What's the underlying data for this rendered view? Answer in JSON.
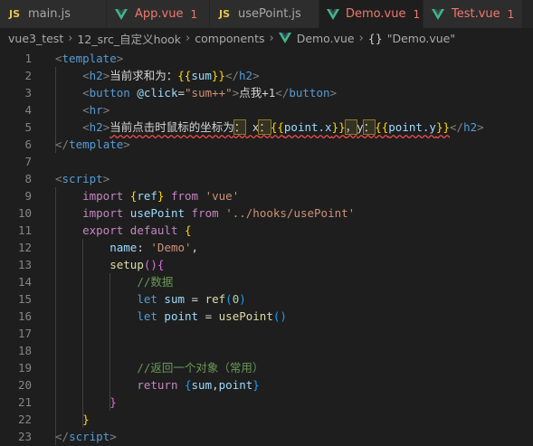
{
  "tabs": [
    {
      "icon": "js-file-icon",
      "icon_text": "JS",
      "label": "main.js",
      "badge": "",
      "active": false,
      "error": false,
      "close": ""
    },
    {
      "icon": "vue-file-icon",
      "icon_text": "",
      "label": "App.vue",
      "badge": "1",
      "active": false,
      "error": true,
      "close": ""
    },
    {
      "icon": "js-file-icon",
      "icon_text": "JS",
      "label": "usePoint.js",
      "badge": "",
      "active": false,
      "error": false,
      "close": ""
    },
    {
      "icon": "vue-file-icon",
      "icon_text": "",
      "label": "Demo.vue",
      "badge": "1",
      "active": true,
      "error": true,
      "close": "×"
    },
    {
      "icon": "vue-file-icon",
      "icon_text": "",
      "label": "Test.vue",
      "badge": "1",
      "active": false,
      "error": true,
      "close": ""
    }
  ],
  "breadcrumb": {
    "items": [
      "vue3_test",
      "12_src_自定义hook",
      "components",
      "Demo.vue"
    ],
    "symbol_icon": "{}",
    "symbol_label": "\"Demo.vue\""
  },
  "colors": {
    "background": "#1e1e1e",
    "tab_bar": "#252526",
    "error_text": "#f0786e",
    "vue_green": "#41b883",
    "js_yellow": "#e6c84f"
  },
  "code_lines": [
    {
      "n": "1"
    },
    {
      "n": "2"
    },
    {
      "n": "3"
    },
    {
      "n": "4"
    },
    {
      "n": "5"
    },
    {
      "n": "6"
    },
    {
      "n": "7"
    },
    {
      "n": "8"
    },
    {
      "n": "9"
    },
    {
      "n": "10"
    },
    {
      "n": "11"
    },
    {
      "n": "12"
    },
    {
      "n": "13"
    },
    {
      "n": "14"
    },
    {
      "n": "15"
    },
    {
      "n": "16"
    },
    {
      "n": "17"
    },
    {
      "n": "18"
    },
    {
      "n": "19"
    },
    {
      "n": "20"
    },
    {
      "n": "21"
    },
    {
      "n": "22"
    },
    {
      "n": "23"
    }
  ],
  "code": {
    "l1": [
      [
        "punc",
        "<"
      ],
      [
        "tag",
        "template"
      ],
      [
        "punc",
        ">"
      ]
    ],
    "l2": [
      [
        "txt",
        "    "
      ],
      [
        "punc",
        "<"
      ],
      [
        "tag",
        "h2"
      ],
      [
        "punc",
        ">"
      ],
      [
        "txt",
        "当前求和为："
      ],
      [
        "brk1",
        "{{"
      ],
      [
        "var",
        "sum"
      ],
      [
        "brk1",
        "}}"
      ],
      [
        "punc",
        "</"
      ],
      [
        "tag",
        "h2"
      ],
      [
        "punc",
        ">"
      ]
    ],
    "l3": [
      [
        "txt",
        "    "
      ],
      [
        "punc",
        "<"
      ],
      [
        "tag",
        "button"
      ],
      [
        "txt",
        " "
      ],
      [
        "attr",
        "@click"
      ],
      [
        "txt",
        "="
      ],
      [
        "str",
        "\"sum++\""
      ],
      [
        "punc",
        ">"
      ],
      [
        "txt",
        "点我+1"
      ],
      [
        "punc",
        "</"
      ],
      [
        "tag",
        "button"
      ],
      [
        "punc",
        ">"
      ]
    ],
    "l4": [
      [
        "txt",
        "    "
      ],
      [
        "punc",
        "<"
      ],
      [
        "tag",
        "hr"
      ],
      [
        "punc",
        ">"
      ]
    ],
    "l5": [
      [
        "txt",
        "    "
      ],
      [
        "punc",
        "<"
      ],
      [
        "tag",
        "h2"
      ],
      [
        "punc",
        ">"
      ],
      [
        "txt squig",
        "当前点击时鼠标的坐标为"
      ],
      [
        "txt squig hl",
        "："
      ],
      [
        "txt squig",
        " x"
      ],
      [
        "txt squig hl",
        "："
      ],
      [
        "brk1 squig",
        "{{"
      ],
      [
        "var squig",
        "point.x"
      ],
      [
        "brk1 squig",
        "}}"
      ],
      [
        "txt squig hl",
        "，"
      ],
      [
        "txt squig",
        "y"
      ],
      [
        "txt squig hl",
        "："
      ],
      [
        "brk1 squig",
        "{{"
      ],
      [
        "var squig",
        "point.y"
      ],
      [
        "brk1 squig",
        "}}"
      ],
      [
        "punc",
        "</"
      ],
      [
        "tag",
        "h2"
      ],
      [
        "punc",
        ">"
      ]
    ],
    "l6": [
      [
        "punc",
        "</"
      ],
      [
        "tag",
        "template"
      ],
      [
        "punc",
        ">"
      ]
    ],
    "l7": [],
    "l8": [
      [
        "punc",
        "<"
      ],
      [
        "tag",
        "script"
      ],
      [
        "punc",
        ">"
      ]
    ],
    "l9": [
      [
        "txt",
        "    "
      ],
      [
        "kw",
        "import"
      ],
      [
        "txt",
        " "
      ],
      [
        "brk1",
        "{"
      ],
      [
        "var",
        "ref"
      ],
      [
        "brk1",
        "}"
      ],
      [
        "txt",
        " "
      ],
      [
        "kw",
        "from"
      ],
      [
        "txt",
        " "
      ],
      [
        "str",
        "'vue'"
      ]
    ],
    "l10": [
      [
        "txt",
        "    "
      ],
      [
        "kw",
        "import"
      ],
      [
        "txt",
        " "
      ],
      [
        "var",
        "usePoint"
      ],
      [
        "txt",
        " "
      ],
      [
        "kw",
        "from"
      ],
      [
        "txt",
        " "
      ],
      [
        "str",
        "'../hooks/usePoint'"
      ]
    ],
    "l11": [
      [
        "txt",
        "    "
      ],
      [
        "kw",
        "export"
      ],
      [
        "txt",
        " "
      ],
      [
        "kw",
        "default"
      ],
      [
        "txt",
        " "
      ],
      [
        "brk1",
        "{"
      ]
    ],
    "l12": [
      [
        "txt",
        "        "
      ],
      [
        "var",
        "name"
      ],
      [
        "txt",
        ": "
      ],
      [
        "str",
        "'Demo'"
      ],
      [
        "txt",
        ","
      ]
    ],
    "l13": [
      [
        "txt",
        "        "
      ],
      [
        "fn",
        "setup"
      ],
      [
        "brk2",
        "()"
      ],
      [
        "brk2",
        "{"
      ]
    ],
    "l14": [
      [
        "txt",
        "            "
      ],
      [
        "cmt",
        "//数据"
      ]
    ],
    "l15": [
      [
        "txt",
        "            "
      ],
      [
        "kw2",
        "let"
      ],
      [
        "txt",
        " "
      ],
      [
        "var",
        "sum"
      ],
      [
        "txt",
        " = "
      ],
      [
        "fn",
        "ref"
      ],
      [
        "brk3",
        "("
      ],
      [
        "num",
        "0"
      ],
      [
        "brk3",
        ")"
      ]
    ],
    "l16": [
      [
        "txt",
        "            "
      ],
      [
        "kw2",
        "let"
      ],
      [
        "txt",
        " "
      ],
      [
        "var",
        "point"
      ],
      [
        "txt",
        " = "
      ],
      [
        "fn",
        "usePoint"
      ],
      [
        "brk3",
        "()"
      ]
    ],
    "l17": [],
    "l18": [],
    "l19": [
      [
        "txt",
        "            "
      ],
      [
        "cmt",
        "//返回一个对象（常用）"
      ]
    ],
    "l20": [
      [
        "txt",
        "            "
      ],
      [
        "kw",
        "return"
      ],
      [
        "txt",
        " "
      ],
      [
        "brk3",
        "{"
      ],
      [
        "var",
        "sum"
      ],
      [
        "txt",
        ","
      ],
      [
        "var",
        "point"
      ],
      [
        "brk3",
        "}"
      ]
    ],
    "l21": [
      [
        "txt",
        "        "
      ],
      [
        "brk2",
        "}"
      ]
    ],
    "l22": [
      [
        "txt",
        "    "
      ],
      [
        "brk1",
        "}"
      ]
    ],
    "l23": [
      [
        "punc",
        "</"
      ],
      [
        "tag",
        "script"
      ],
      [
        "punc",
        ">"
      ]
    ]
  }
}
